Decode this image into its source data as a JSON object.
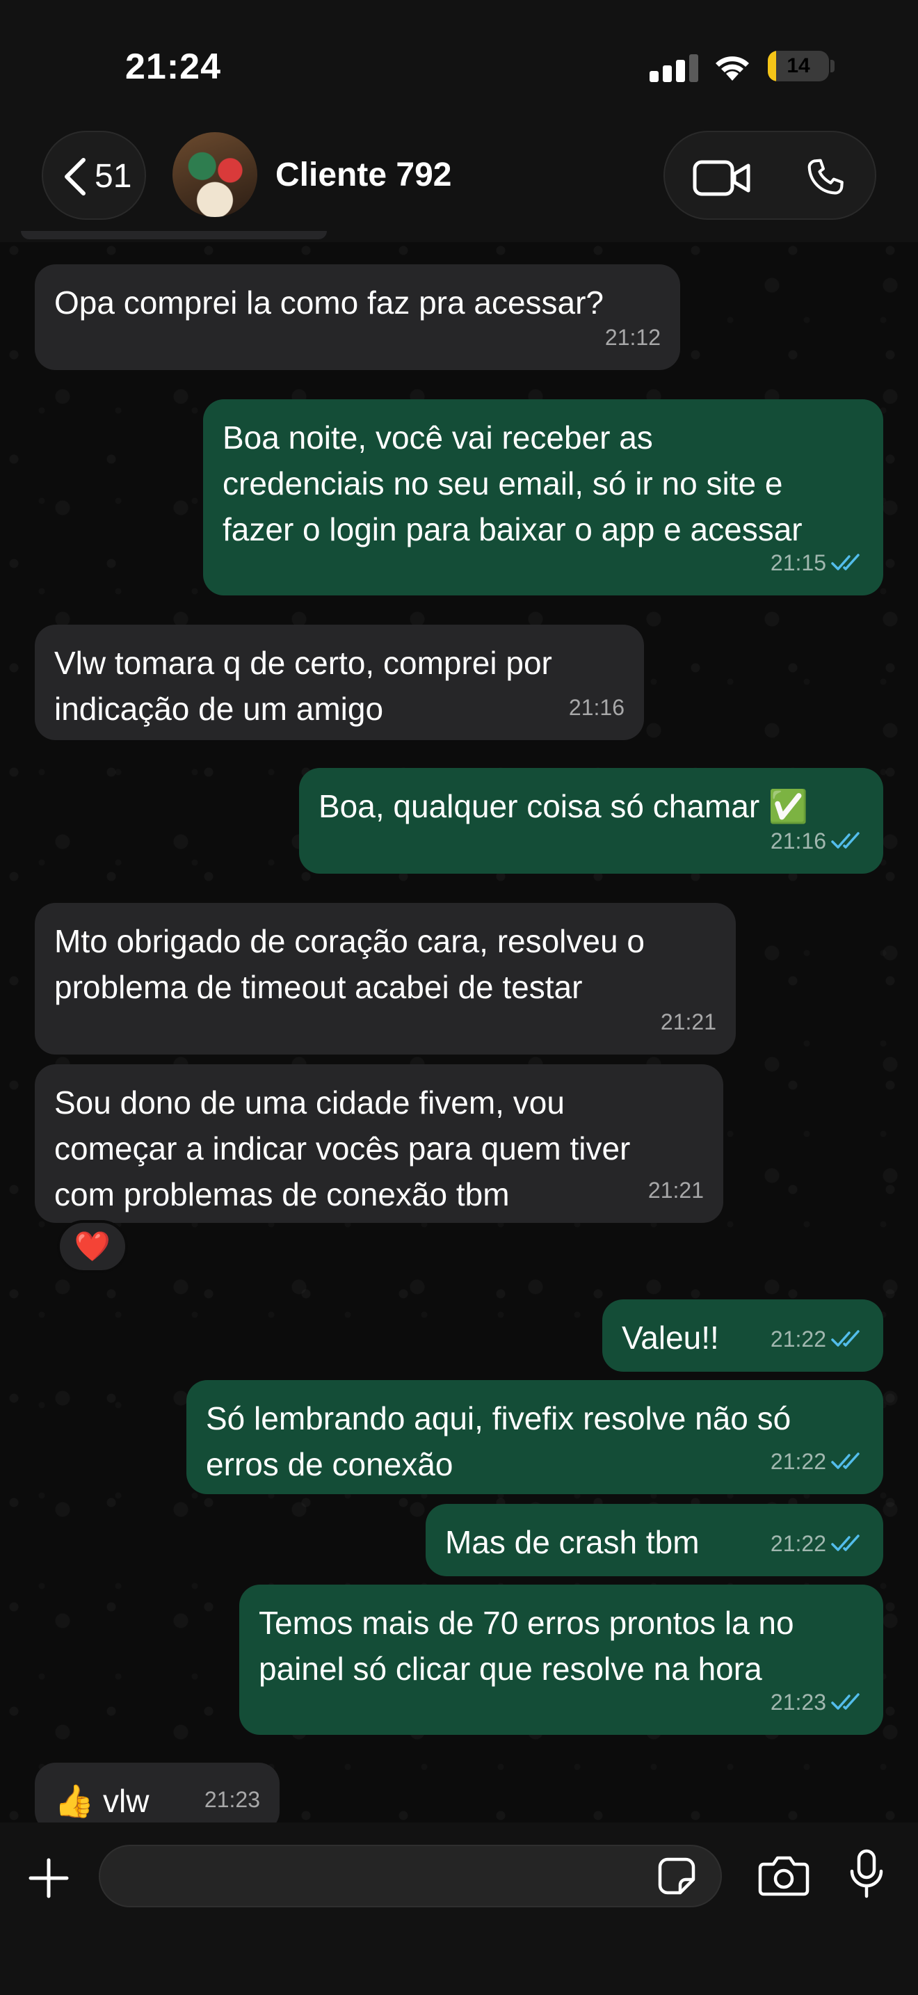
{
  "status_bar": {
    "time": "21:24",
    "battery_level": "14",
    "signal_bars": 3
  },
  "header": {
    "back_count": "51",
    "contact_name": "Cliente 792"
  },
  "messages": [
    {
      "direction": "in",
      "text": "Opa comprei la como faz pra acessar?",
      "time": "21:12"
    },
    {
      "direction": "out",
      "text": "Boa noite, você vai receber as\ncredenciais no seu email, só ir no site e\nfazer o login para baixar o app e acessar",
      "time": "21:15",
      "status": "read"
    },
    {
      "direction": "in",
      "text": "Vlw tomara q de certo, comprei por\nindicação de um amigo",
      "time": "21:16"
    },
    {
      "direction": "out",
      "text": "Boa, qualquer coisa só chamar ✅",
      "time": "21:16",
      "status": "read"
    },
    {
      "direction": "in",
      "text": "Mto obrigado de coração cara, resolveu o\nproblema de timeout acabei de testar",
      "time": "21:21"
    },
    {
      "direction": "in",
      "text": "Sou dono de uma cidade fivem, vou\ncomeçar a indicar vocês para quem tiver\ncom problemas de conexão tbm",
      "time": "21:21",
      "reaction": "❤️"
    },
    {
      "direction": "out",
      "text": "Valeu!!",
      "time": "21:22",
      "status": "read"
    },
    {
      "direction": "out",
      "text": "Só lembrando aqui, fivefix resolve não só\nerros de conexão",
      "time": "21:22",
      "status": "read"
    },
    {
      "direction": "out",
      "text": "Mas de crash tbm",
      "time": "21:22",
      "status": "read"
    },
    {
      "direction": "out",
      "text": "Temos mais de 70 erros prontos la no\npainel só clicar que resolve na hora",
      "time": "21:23",
      "status": "read"
    },
    {
      "direction": "in",
      "text": "👍 vlw",
      "time": "21:23"
    }
  ],
  "composer": {
    "placeholder": ""
  },
  "colors": {
    "incoming_bubble": "#262628",
    "outgoing_bubble": "#144d37",
    "read_ticks": "#53bdeb",
    "battery_low": "#f5c518"
  },
  "icons": [
    "chevron-left-icon",
    "video-call-icon",
    "phone-icon",
    "plus-icon",
    "sticker-icon",
    "camera-icon",
    "microphone-icon",
    "double-check-icon"
  ]
}
